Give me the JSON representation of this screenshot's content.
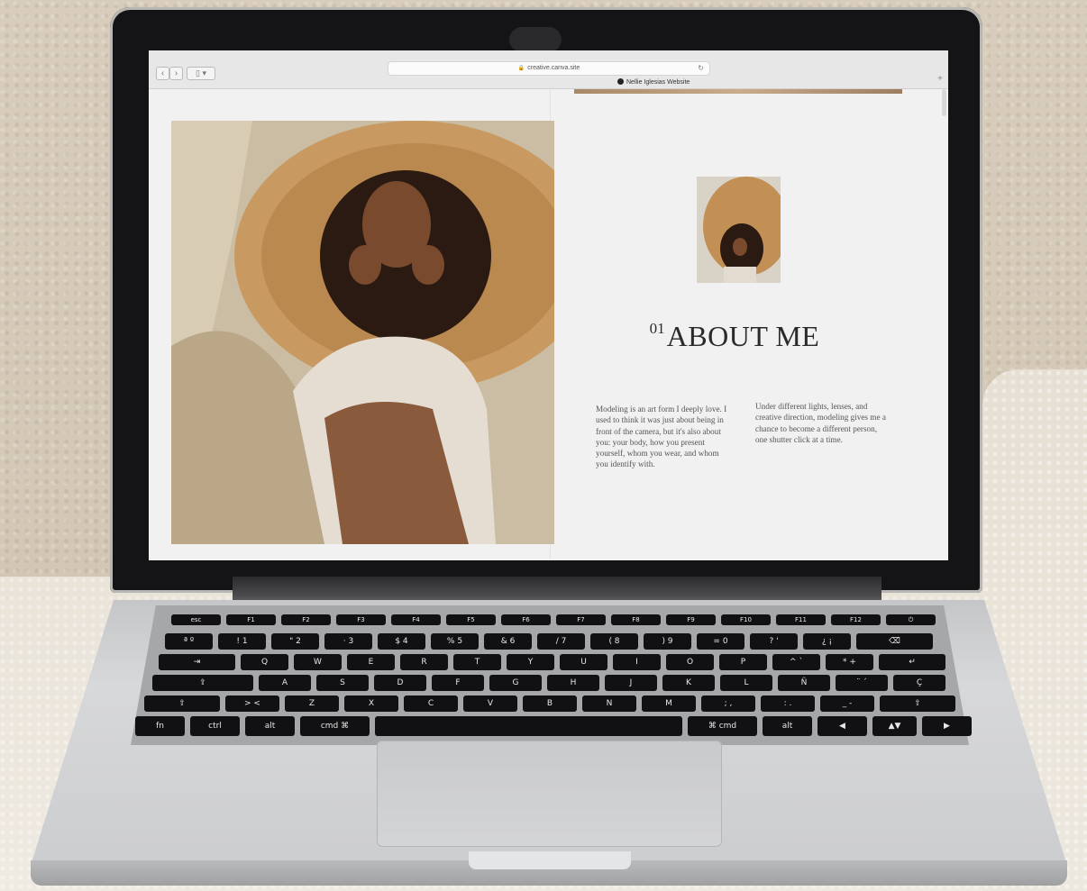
{
  "browser": {
    "back_glyph": "‹",
    "forward_glyph": "›",
    "sidebar_glyph": "▯ ▾",
    "url": "creative.canva.site",
    "tab_title": "Nellie Iglesias Website",
    "new_tab_glyph": "+"
  },
  "page": {
    "section_number": "01",
    "section_title": "ABOUT ME",
    "paragraph_left": "Modeling is an art form I deeply love. I used to think it was just about being in front of the camera, but it's also about you: your body, how you present yourself, whom you wear, and whom you identify with.",
    "paragraph_right": "Under different lights, lenses, and creative direction, modeling gives me a chance to become a different person, one shutter click at a time."
  },
  "keyboard": {
    "rows": [
      [
        "esc",
        "F1",
        "F2",
        "F3",
        "F4",
        "F5",
        "F6",
        "F7",
        "F8",
        "F9",
        "F10",
        "F11",
        "F12",
        "⏻"
      ],
      [
        "ª º",
        "! 1",
        "\" 2",
        "· 3",
        "$ 4",
        "% 5",
        "& 6",
        "/ 7",
        "( 8",
        ") 9",
        "= 0",
        "? '",
        "¿ ¡",
        "⌫"
      ],
      [
        "⇥",
        "Q",
        "W",
        "E",
        "R",
        "T",
        "Y",
        "U",
        "I",
        "O",
        "P",
        "^ `",
        "* +",
        "↵"
      ],
      [
        "⇪",
        "A",
        "S",
        "D",
        "F",
        "G",
        "H",
        "J",
        "K",
        "L",
        "Ñ",
        "¨ ´",
        "Ç"
      ],
      [
        "⇧",
        "> <",
        "Z",
        "X",
        "C",
        "V",
        "B",
        "N",
        "M",
        "; ,",
        ": .",
        "_ -",
        "⇧"
      ],
      [
        "fn",
        "ctrl",
        "alt",
        "cmd ⌘",
        "",
        "⌘ cmd",
        "alt",
        "◀",
        "▲▼",
        "▶"
      ]
    ]
  }
}
